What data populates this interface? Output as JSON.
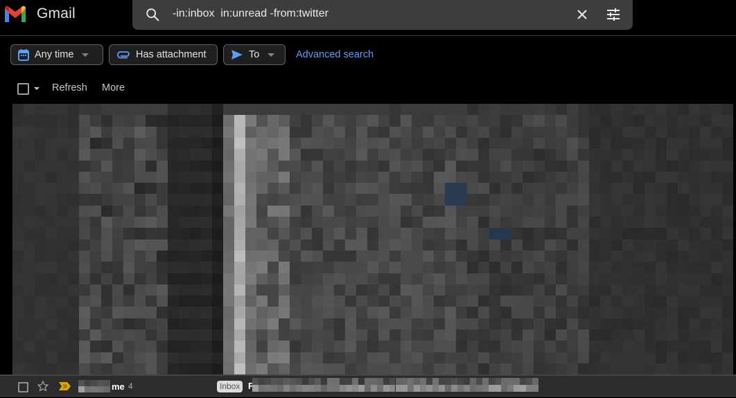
{
  "app": {
    "name": "Gmail"
  },
  "search": {
    "query": "-in:inbox  in:unread -from:twitter",
    "icons": {
      "search": "search-icon",
      "clear": "close-icon",
      "options": "tune-icon"
    }
  },
  "filters": {
    "chips": [
      {
        "label": "Any time",
        "icon": "calendar-icon",
        "has_dropdown": true
      },
      {
        "label": "Has attachment",
        "icon": "paperclip-icon",
        "has_dropdown": false
      },
      {
        "label": "To",
        "icon": "send-icon",
        "has_dropdown": true
      }
    ],
    "advanced_search_label": "Advanced search"
  },
  "toolbar": {
    "refresh_label": "Refresh",
    "more_label": "More"
  },
  "mail_list": {
    "obscured": true,
    "visible_row": {
      "sender_suffix": "me",
      "thread_count": "4",
      "label_badge": "Inbox",
      "subject_start": "F",
      "starred": false,
      "important": true
    }
  },
  "colors": {
    "background": "#000000",
    "search_bg": "#3c3e3d",
    "accent_blue": "#5e9df6",
    "important_marker": "#e0a800",
    "row_bg": "#2c2c2c"
  }
}
